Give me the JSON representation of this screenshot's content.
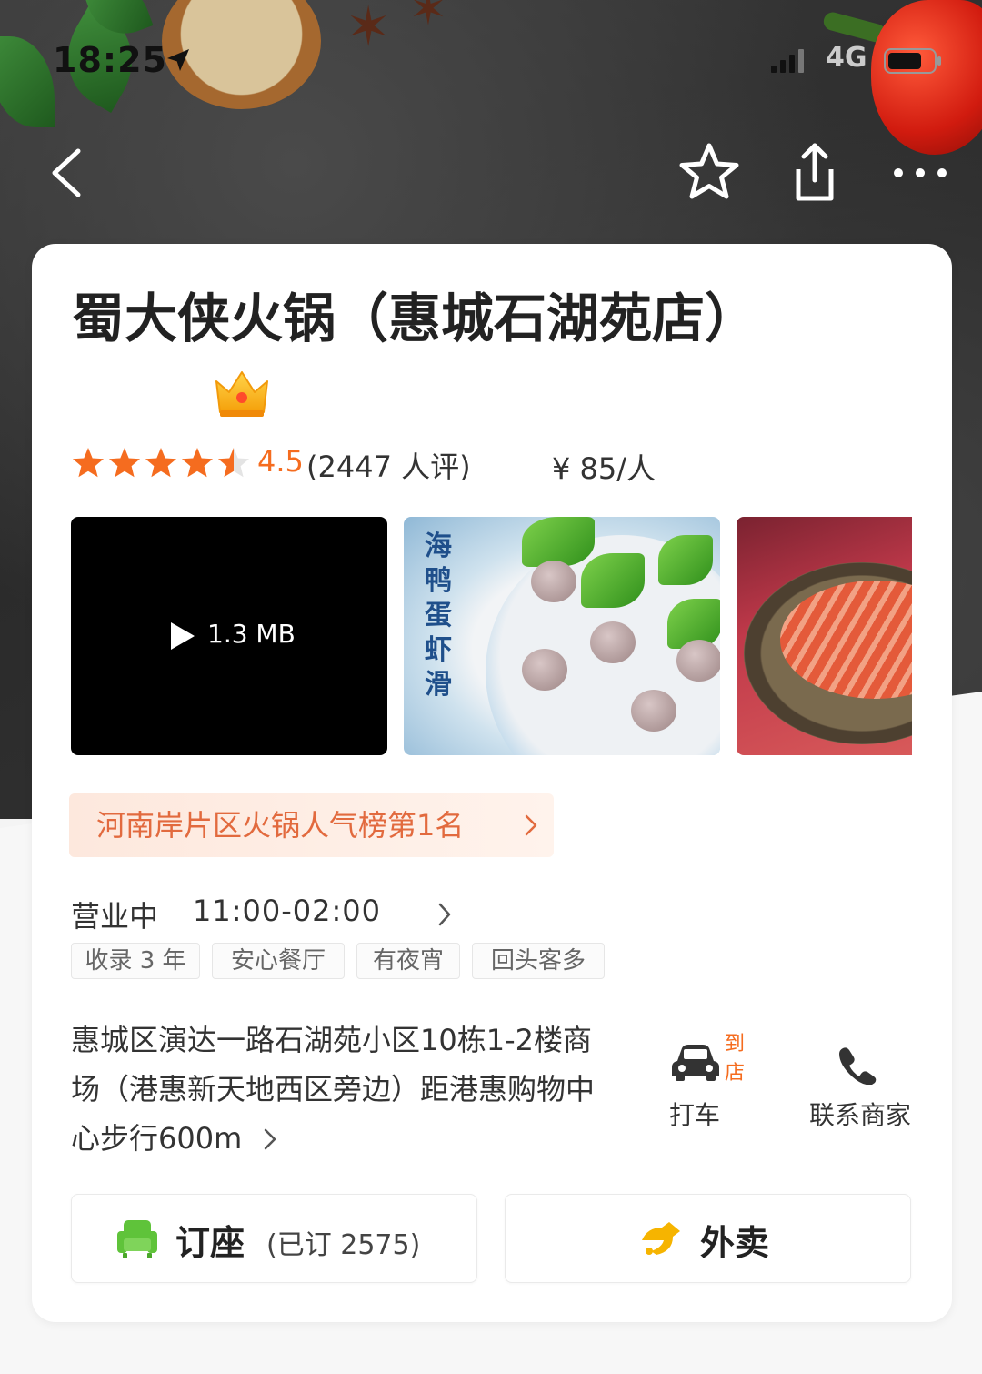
{
  "status_bar": {
    "time": "18:25",
    "network": "4G"
  },
  "nav": {
    "back_icon": "chevron-left-icon",
    "favorite_icon": "star-outline-icon",
    "share_icon": "share-icon",
    "more_icon": "more-dots-icon"
  },
  "restaurant": {
    "name": "蜀大侠火锅（惠城石湖苑店）",
    "badge_icon": "crown-icon",
    "rating_value": "4.5",
    "rating_stars": 4.5,
    "review_count": "(2447 人评)",
    "price": "¥ 85/人"
  },
  "media": {
    "video_size": "1.3 MB",
    "photo1_caption": "海鸭蛋虾滑"
  },
  "ranking": {
    "label": "河南岸片区火锅人气榜第1名"
  },
  "hours": {
    "status": "营业中",
    "time": "11:00-02:00"
  },
  "tags": [
    "收录 3 年",
    "安心餐厅",
    "有夜宵",
    "回头客多"
  ],
  "address": {
    "text": "惠城区演达一路石湖苑小区10栋1-2楼商场（港惠新天地西区旁边）距港惠购物中心步行600m"
  },
  "quick_actions": {
    "taxi_badge": "到店",
    "taxi_label": "打车",
    "contact_label": "联系商家"
  },
  "bottom_actions": {
    "reserve_label": "订座",
    "reserve_count": "(已订 2575)",
    "delivery_label": "外卖"
  },
  "colors": {
    "accent_orange": "#f56c1f",
    "rank_text": "#e26a3e",
    "sofa_green": "#5fc33a",
    "rider_yellow": "#f6b400"
  }
}
